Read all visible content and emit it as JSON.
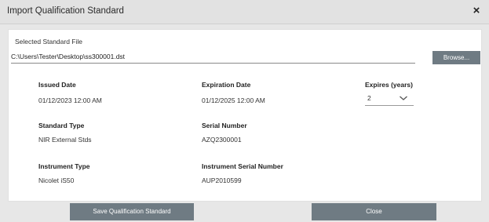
{
  "window": {
    "title": "Import Qualification Standard",
    "close_glyph": "×"
  },
  "file": {
    "label": "Selected Standard File",
    "path": "C:\\Users\\Tester\\Desktop\\ss300001.dst",
    "browse_label": "Browse..."
  },
  "fields": {
    "issued_date": {
      "label": "Issued Date",
      "value": "01/12/2023 12:00 AM"
    },
    "expiration_date": {
      "label": "Expiration Date",
      "value": "01/12/2025 12:00 AM"
    },
    "expires_years": {
      "label": "Expires (years)",
      "value": "2"
    },
    "standard_type": {
      "label": "Standard Type",
      "value": "NIR External Stds"
    },
    "serial_number": {
      "label": "Serial Number",
      "value": "AZQ2300001"
    },
    "instrument_type": {
      "label": "Instrument Type",
      "value": "Nicolet iS50"
    },
    "instrument_serial_number": {
      "label": "Instrument Serial Number",
      "value": "AUP2010599"
    }
  },
  "footer": {
    "save_label": "Save Qualification Standard",
    "close_label": "Close"
  },
  "colors": {
    "button_bg": "#6f7b83",
    "panel_bg": "#ffffff",
    "window_bg": "#e7e7e7"
  },
  "icons": {
    "close": "close-icon",
    "dropdown": "chevron-down-icon"
  }
}
